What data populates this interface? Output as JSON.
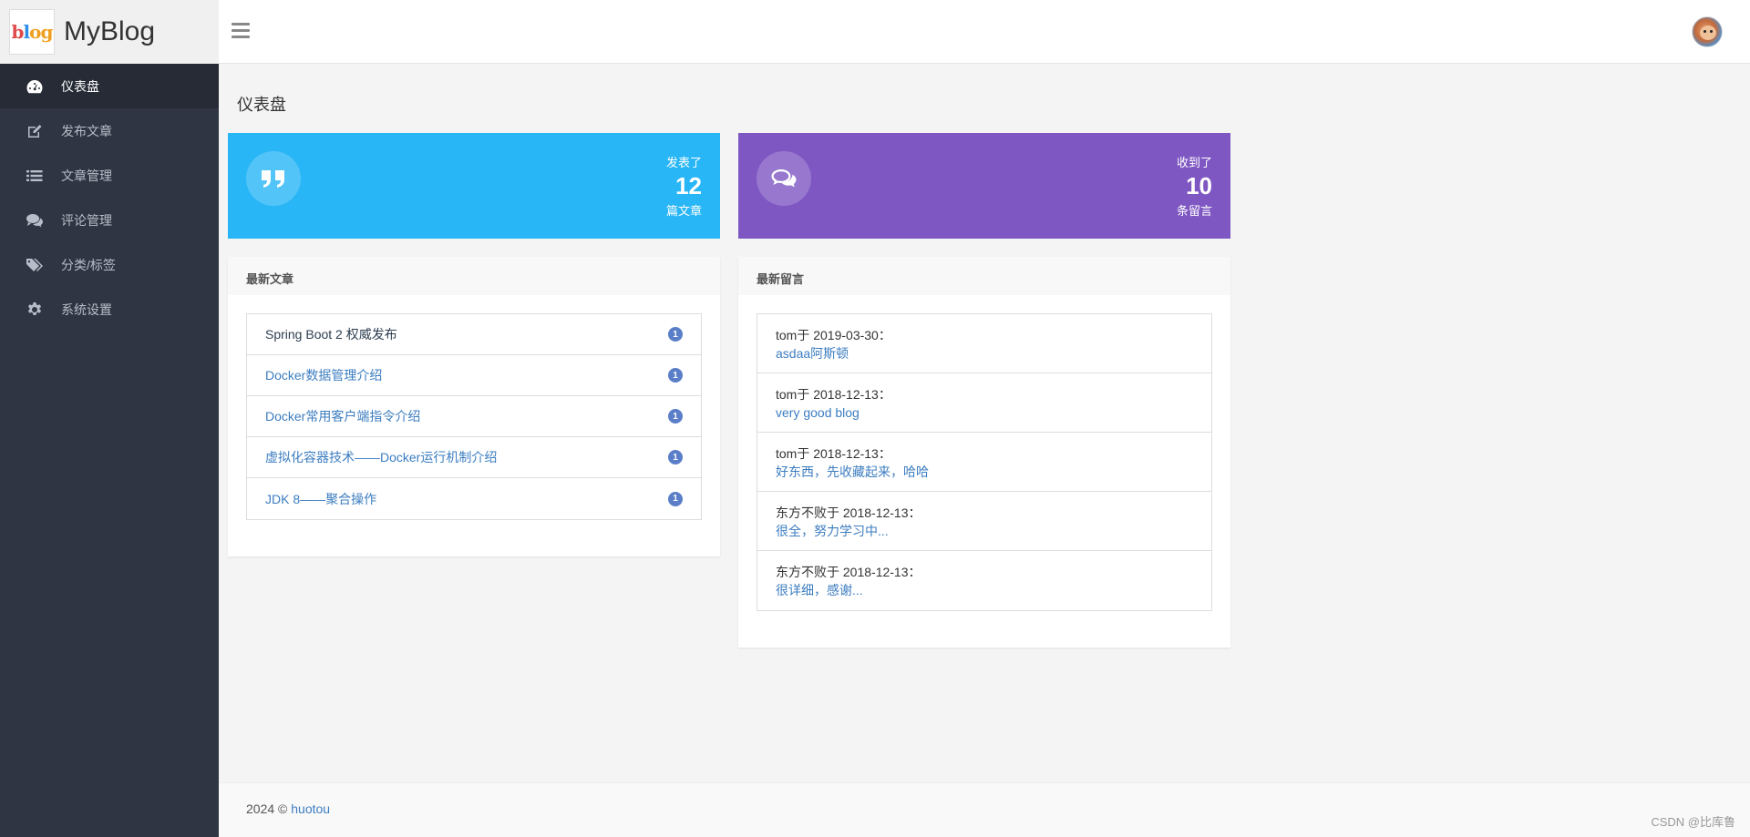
{
  "brand": {
    "name": "MyBlog",
    "logo_text": [
      "b",
      "l",
      "og"
    ]
  },
  "sidebar": {
    "items": [
      {
        "label": "仪表盘",
        "icon": "dashboard-icon",
        "active": true
      },
      {
        "label": "发布文章",
        "icon": "edit-icon"
      },
      {
        "label": "文章管理",
        "icon": "list-icon"
      },
      {
        "label": "评论管理",
        "icon": "comments-icon"
      },
      {
        "label": "分类/标签",
        "icon": "tags-icon"
      },
      {
        "label": "系统设置",
        "icon": "gear-icon"
      }
    ]
  },
  "header": {
    "menu_icon": "hamburger-icon",
    "avatar_icon": "user-avatar"
  },
  "main": {
    "title": "仪表盘",
    "stats": [
      {
        "pre": "发表了",
        "value": "12",
        "post": "篇文章",
        "color": "#29b6f6",
        "icon": "quote-icon"
      },
      {
        "pre": "收到了",
        "value": "10",
        "post": "条留言",
        "color": "#7e57c2",
        "icon": "comments-icon"
      }
    ],
    "articles_panel": {
      "title": "最新文章",
      "items": [
        {
          "title": "Spring Boot 2 权威发布",
          "count": "1"
        },
        {
          "title": "Docker数据管理介绍",
          "count": "1"
        },
        {
          "title": "Docker常用客户端指令介绍",
          "count": "1"
        },
        {
          "title": "虚拟化容器技术——Docker运行机制介绍",
          "count": "1"
        },
        {
          "title": "JDK 8——聚合操作",
          "count": "1"
        }
      ]
    },
    "comments_panel": {
      "title": "最新留言",
      "items": [
        {
          "meta": "tom于 2019-03-30：",
          "text": "asdaa阿斯顿"
        },
        {
          "meta": "tom于 2018-12-13：",
          "text": "very good blog"
        },
        {
          "meta": "tom于 2018-12-13：",
          "text": "好东西，先收藏起来，哈哈"
        },
        {
          "meta": "东方不败于 2018-12-13：",
          "text": "很全，努力学习中..."
        },
        {
          "meta": "东方不败于 2018-12-13：",
          "text": "很详细，感谢..."
        }
      ]
    }
  },
  "footer": {
    "text": "2024 © ",
    "link": "huotou"
  },
  "watermark": "CSDN @比库鲁",
  "colors": {
    "sidebar_bg": "#2f3542",
    "link": "#3c7dc0",
    "badge": "#5a7fc8"
  }
}
